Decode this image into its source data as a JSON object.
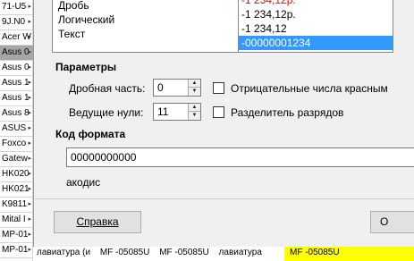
{
  "sheet": {
    "rows": [
      "71-U5",
      "9J.N0",
      "Acer W",
      "Asus 0",
      "Asus 0",
      "Asus 1",
      "Asus 1",
      "Asus 8",
      "ASUS",
      "Foxco",
      "Gatew",
      "HK020",
      "HK021",
      "K9811",
      "Mital I",
      "MP-01",
      "MP-01"
    ],
    "bottom_segments": [
      "лавиатура (и",
      "MF -05085U",
      "MF -05085U",
      "лавиатура",
      "MF -05085U"
    ]
  },
  "format_list": {
    "items": [
      "Дробь",
      "Логический",
      "Текст"
    ]
  },
  "sample_list": {
    "items": [
      "-1 234,12р.",
      "-1 234,12р.",
      "-1 234,12",
      "-00000001234"
    ]
  },
  "params": {
    "title": "Параметры",
    "decimal_label": "Дробная часть:",
    "decimal_value": "0",
    "leading_zeros_label": "Ведущие нули:",
    "leading_zeros_value": "11",
    "negative_red_label": "Отрицательные числа красным",
    "thousands_sep_label": "Разделитель разрядов"
  },
  "code": {
    "title": "Код формата",
    "value": "00000000000",
    "below_text": "акодис"
  },
  "buttons": {
    "help_label": "Справка",
    "ok_label": "О"
  }
}
